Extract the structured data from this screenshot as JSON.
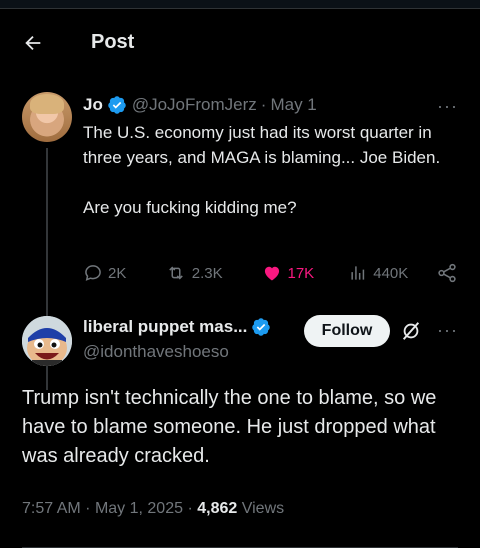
{
  "header": {
    "title": "Post"
  },
  "parent_post": {
    "author_name": "Jo",
    "handle": "@JoJoFromJerz",
    "separator": "·",
    "date": "May 1",
    "more": "···",
    "text_line1": "The U.S. economy just had its worst quarter in three years, and MAGA is blaming... Joe Biden.",
    "text_line2": "Are you fucking kidding me?",
    "stats": {
      "replies": "2K",
      "reposts": "2.3K",
      "likes": "17K",
      "views": "440K"
    },
    "like_color": "#f91880"
  },
  "main_post": {
    "author_name": "liberal puppet mas...",
    "handle": "@idonthaveshoeso",
    "follow_label": "Follow",
    "more": "···",
    "text": "Trump isn't technically the one to blame, so we have to blame someone. He just dropped what was already cracked.",
    "time": "7:57 AM",
    "separator": "·",
    "date": "May 1, 2025",
    "views_count": "4,862",
    "views_label": "Views"
  },
  "icons": {
    "back": "arrow-left-icon",
    "verified": "verified-badge-icon",
    "reply": "speech-bubble-icon",
    "repost": "repost-icon",
    "like": "heart-icon",
    "views": "bar-chart-icon",
    "share": "share-icon",
    "grok": "grok-icon"
  },
  "colors": {
    "background": "#000000",
    "text": "#e7e9ea",
    "muted": "#71767b",
    "verified": "#1d9bf0",
    "like": "#f91880"
  }
}
